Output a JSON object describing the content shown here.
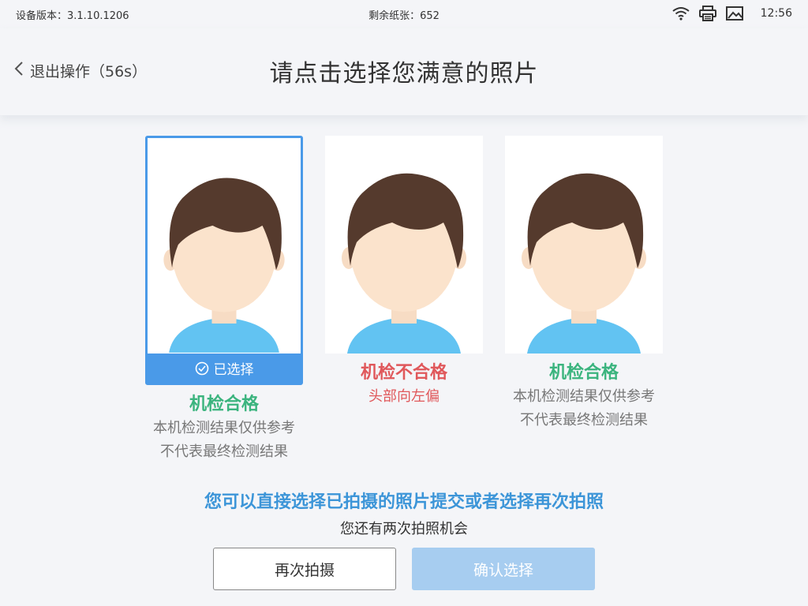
{
  "status_bar": {
    "device_version": "设备版本：3.1.10.1206",
    "paper_remaining": "剩余纸张：652",
    "time": "12:56",
    "icons": [
      "wifi-icon",
      "printer-icon",
      "image-icon"
    ]
  },
  "header": {
    "back_label": "退出操作（56s）",
    "title": "请点击选择您满意的照片"
  },
  "photos": [
    {
      "selected": true,
      "selected_label": "已选择",
      "result": "机检合格",
      "result_status": "pass",
      "notes": [
        "本机检测结果仅供参考",
        "不代表最终检测结果"
      ]
    },
    {
      "selected": false,
      "result": "机检不合格",
      "result_status": "fail",
      "notes": [
        "头部向左偏"
      ]
    },
    {
      "selected": false,
      "result": "机检合格",
      "result_status": "pass",
      "notes": [
        "本机检测结果仅供参考",
        "不代表最终检测结果"
      ]
    }
  ],
  "tips": {
    "main": "您可以直接选择已拍摄的照片提交或者选择再次拍照",
    "sub": "您还有两次拍照机会"
  },
  "buttons": {
    "retake": "再次拍摄",
    "confirm": "确认选择"
  },
  "colors": {
    "accent": "#4a9ae8",
    "pass": "#3bb47e",
    "fail": "#e0585b",
    "confirm_disabled": "#a7cdf0"
  }
}
